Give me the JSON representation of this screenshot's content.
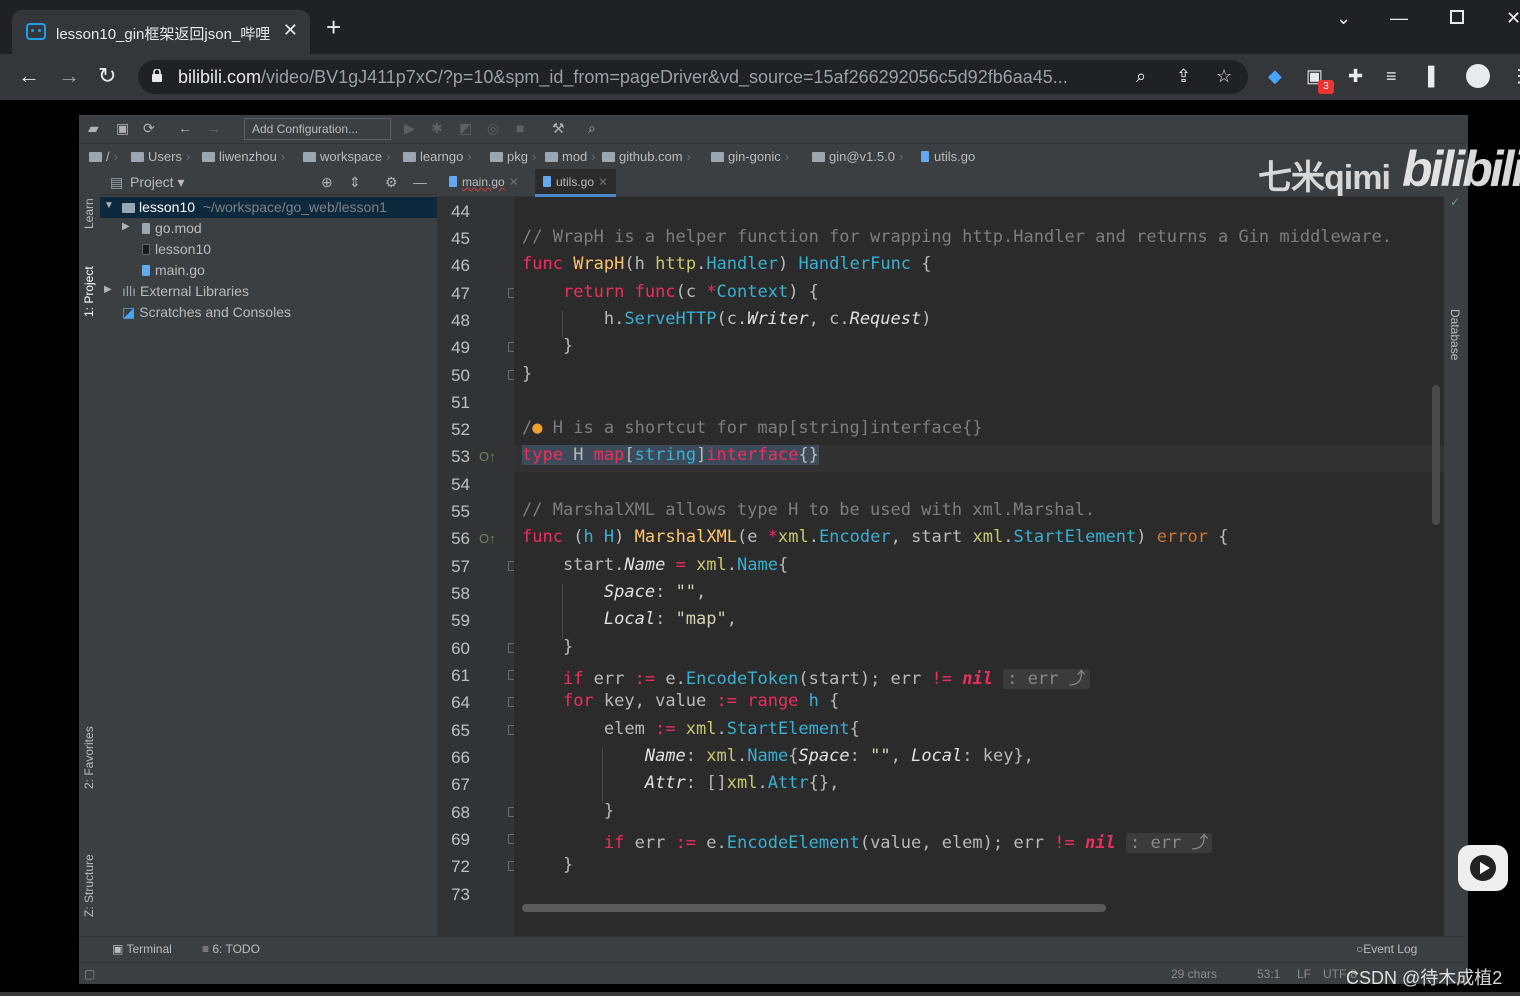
{
  "browser": {
    "tab_title": "lesson10_gin框架返回json_哔哩",
    "close_glyph": "✕",
    "new_tab_glyph": "+",
    "url_host": "bilibili.com",
    "url_path": "/video/BV1gJ411p7xC/?p=10&spm_id_from=pageDriver&vd_source=15af266292056c5d92fb6aa45...",
    "extension_badge": "3"
  },
  "ide": {
    "toolbar": {
      "add_configuration": "Add Configuration..."
    },
    "breadcrumbs": [
      "/",
      "Users",
      "liwenzhou",
      "workspace",
      "learngo",
      "pkg",
      "mod",
      "github.com",
      "gin-gonic",
      "gin@v1.5.0",
      "utils.go"
    ],
    "left_strip": {
      "learn": "Learn",
      "project": "1: Project",
      "favorites": "2: Favorites",
      "structure": "Z: Structure"
    },
    "right_strip": {
      "database": "Database"
    },
    "project_panel": {
      "title": "Project",
      "tree": [
        {
          "label": "lesson10",
          "path": "~/workspace/go_web/lesson1"
        },
        {
          "label": "go.mod"
        },
        {
          "label": "lesson10"
        },
        {
          "label": "main.go"
        },
        {
          "label": "External Libraries"
        },
        {
          "label": "Scratches and Consoles"
        }
      ]
    },
    "editor_tabs": [
      {
        "label": "main.go"
      },
      {
        "label": "utils.go"
      }
    ],
    "line_numbers": [
      "44",
      "45",
      "46",
      "47",
      "48",
      "49",
      "50",
      "51",
      "52",
      "53",
      "54",
      "55",
      "56",
      "57",
      "58",
      "59",
      "60",
      "61",
      "64",
      "65",
      "66",
      "67",
      "68",
      "69",
      "72",
      "73"
    ],
    "code": {
      "l45": "// WrapH is a helper function for wrapping http.Handler and returns a Gin middleware.",
      "l52a": "/",
      "l52b": " H is a shortcut for map[string]interface{}",
      "l55": "// MarshalXML allows type H to be used with xml.Marshal.",
      "s_empty": "\"\"",
      "s_map": "\"map\"",
      "hint_err": ": err ⤴"
    },
    "bottom_tools": {
      "terminal": "Terminal",
      "todo": "6: TODO",
      "event_log": "Event Log"
    },
    "status": {
      "chars": "29 chars",
      "position": "53:1",
      "line_sep": "LF",
      "encoding": "UTF-8"
    }
  },
  "overlays": {
    "watermark_qimi": "七米qimi",
    "watermark_bilibili": "bilibili",
    "csdn": "CSDN @待木成植2"
  }
}
